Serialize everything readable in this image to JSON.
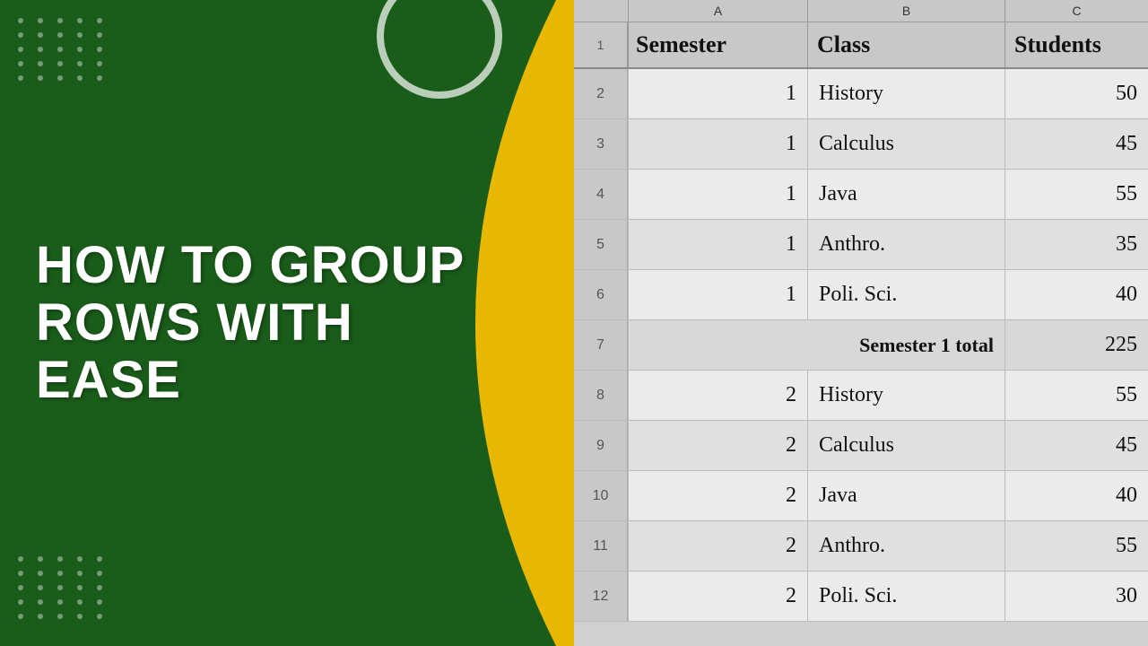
{
  "left": {
    "title_line1": "HOW TO GROUP",
    "title_line2": "ROWS WITH EASE",
    "bg_color": "#1a5c1a"
  },
  "spreadsheet": {
    "col_headers": [
      "A",
      "B",
      "C"
    ],
    "header": {
      "semester": "Semester",
      "class": "Class",
      "students": "Students"
    },
    "rows": [
      {
        "num": "2",
        "semester": "1",
        "class": "History",
        "students": "50",
        "is_total": false
      },
      {
        "num": "3",
        "semester": "1",
        "class": "Calculus",
        "students": "45",
        "is_total": false
      },
      {
        "num": "4",
        "semester": "1",
        "class": "Java",
        "students": "55",
        "is_total": false
      },
      {
        "num": "5",
        "semester": "1",
        "class": "Anthro.",
        "students": "35",
        "is_total": false
      },
      {
        "num": "6",
        "semester": "1",
        "class": "Poli. Sci.",
        "students": "40",
        "is_total": false
      },
      {
        "num": "7",
        "semester": "Semester 1 total",
        "class": "",
        "students": "225",
        "is_total": true
      },
      {
        "num": "8",
        "semester": "2",
        "class": "History",
        "students": "55",
        "is_total": false
      },
      {
        "num": "9",
        "semester": "2",
        "class": "Calculus",
        "students": "45",
        "is_total": false
      },
      {
        "num": "10",
        "semester": "2",
        "class": "Java",
        "students": "40",
        "is_total": false
      },
      {
        "num": "11",
        "semester": "2",
        "class": "Anthro.",
        "students": "55",
        "is_total": false
      },
      {
        "num": "12",
        "semester": "2",
        "class": "Poli. Sci.",
        "students": "30",
        "is_total": false
      }
    ]
  }
}
